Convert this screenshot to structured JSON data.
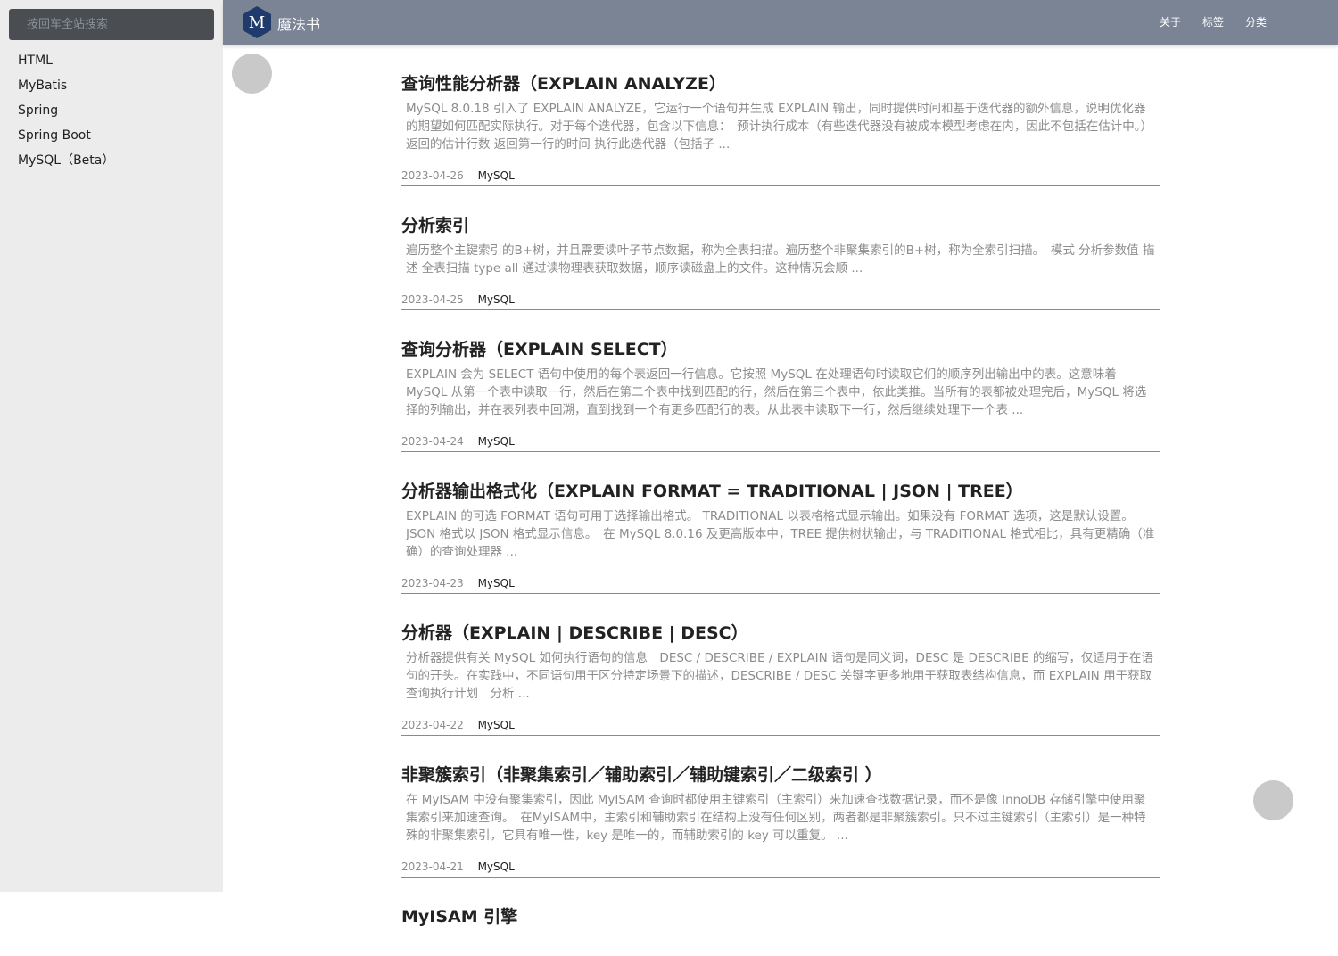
{
  "search": {
    "placeholder": "按回车全站搜索"
  },
  "sidebar": {
    "items": [
      {
        "label": "HTML"
      },
      {
        "label": "MyBatis"
      },
      {
        "label": "Spring"
      },
      {
        "label": "Spring Boot"
      },
      {
        "label": "MySQL（Beta）"
      }
    ]
  },
  "header": {
    "logo_letter": "M",
    "brand": "魔法书",
    "nav": [
      {
        "label": "关于"
      },
      {
        "label": "标签"
      },
      {
        "label": "分类"
      }
    ]
  },
  "posts": [
    {
      "title": "查询性能分析器（EXPLAIN ANALYZE）",
      "excerpt": "MySQL 8.0.18 引入了 EXPLAIN ANALYZE，它运行一个语句并生成 EXPLAIN 输出，同时提供时间和基于迭代器的额外信息，说明优化器的期望如何匹配实际执行。对于每个迭代器，包含以下信息：　预计执行成本（有些迭代器没有被成本模型考虑在内，因此不包括在估计中。） 返回的估计行数 返回第一行的时间 执行此迭代器（包括子 ...",
      "date": "2023-04-26",
      "tag": "MySQL"
    },
    {
      "title": "分析索引",
      "excerpt": "遍历整个主键索引的B+树，并且需要读叶子节点数据，称为全表扫描。遍历整个非聚集索引的B+树，称为全索引扫描。　模式 分析参数值 描述 全表扫描 type all 通过读物理表获取数据，顺序读磁盘上的文件。这种情况会顺 ...",
      "date": "2023-04-25",
      "tag": "MySQL"
    },
    {
      "title": "查询分析器（EXPLAIN SELECT）",
      "excerpt": "EXPLAIN 会为 SELECT 语句中使用的每个表返回一行信息。它按照 MySQL 在处理语句时读取它们的顺序列出输出中的表。这意味着 MySQL 从第一个表中读取一行，然后在第二个表中找到匹配的行，然后在第三个表中，依此类推。当所有的表都被处理完后，MySQL 将选择的列输出，并在表列表中回溯，直到找到一个有更多匹配行的表。从此表中读取下一行，然后继续处理下一个表 ...",
      "date": "2023-04-24",
      "tag": "MySQL"
    },
    {
      "title": "分析器输出格式化（EXPLAIN FORMAT = TRADITIONAL | JSON | TREE）",
      "excerpt": "EXPLAIN 的可选 FORMAT 语句可用于选择输出格式。 TRADITIONAL 以表格格式显示输出。如果没有 FORMAT 选项，这是默认设置。 JSON 格式以 JSON 格式显示信息。　在 MySQL 8.0.16 及更高版本中，TREE 提供树状输出，与 TRADITIONAL 格式相比，具有更精确（准确）的查询处理器 ...",
      "date": "2023-04-23",
      "tag": "MySQL"
    },
    {
      "title": "分析器（EXPLAIN | DESCRIBE | DESC）",
      "excerpt": "分析器提供有关 MySQL 如何执行语句的信息　DESC / DESCRIBE / EXPLAIN 语句是同义词，DESC 是 DESCRIBE 的缩写，仅适用于在语句的开头。在实践中，不同语句用于区分特定场景下的描述，DESCRIBE / DESC 关键字更多地用于获取表结构信息，而 EXPLAIN 用于获取查询执行计划　分析 ...",
      "date": "2023-04-22",
      "tag": "MySQL"
    },
    {
      "title": "非聚簇索引（非聚集索引／辅助索引／辅助键索引／二级索引 ）",
      "excerpt": "在 MyISAM 中没有聚集索引，因此 MyISAM 查询时都使用主键索引（主索引）来加速查找数据记录，而不是像 InnoDB 存储引擎中使用聚集索引来加速查询。　在MyISAM中，主索引和辅助索引在结构上没有任何区别，两者都是非聚簇索引。只不过主键索引（主索引）是一种特殊的非聚集索引，它具有唯一性，key 是唯一的，而辅助索引的 key 可以重复。 ...",
      "date": "2023-04-21",
      "tag": "MySQL"
    },
    {
      "title": "MyISAM 引擎"
    }
  ]
}
